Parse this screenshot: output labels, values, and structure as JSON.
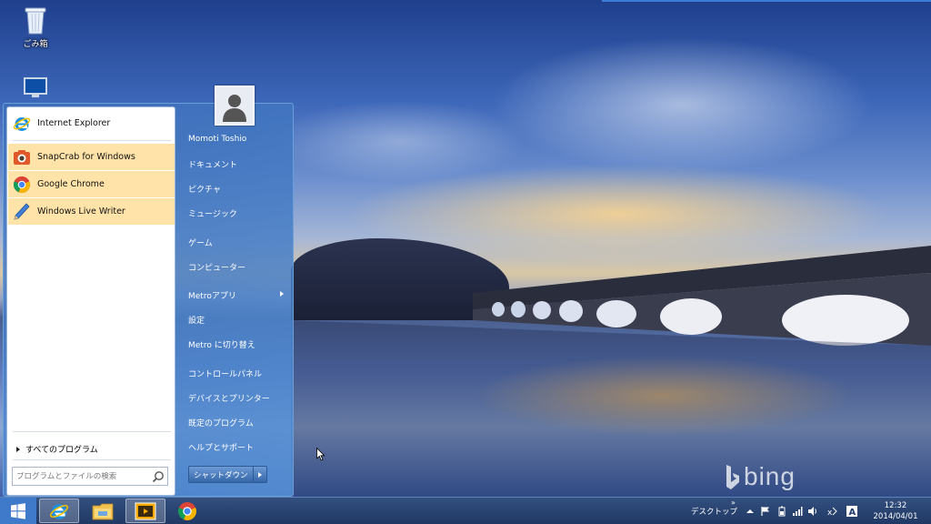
{
  "desktop": {
    "icons": [
      {
        "label": "ごみ箱"
      }
    ]
  },
  "start_menu": {
    "programs": [
      {
        "label": "Internet Explorer",
        "icon": "internet-explorer-icon"
      },
      {
        "label": "SnapCrab for Windows",
        "icon": "snapcrab-icon"
      },
      {
        "label": "Google Chrome",
        "icon": "chrome-icon"
      },
      {
        "label": "Windows Live Writer",
        "icon": "live-writer-icon"
      }
    ],
    "all_programs_label": "すべてのプログラム",
    "search_placeholder": "プログラムとファイルの検索",
    "user_name": "Momoti Toshio",
    "links": [
      "ドキュメント",
      "ピクチャ",
      "ミュージック",
      "ゲーム",
      "コンピューター",
      "Metroアプリ",
      "設定",
      "Metro に切り替え",
      "コントロールパネル",
      "デバイスとプリンター",
      "既定のプログラム",
      "ヘルプとサポート"
    ],
    "shutdown_label": "シャットダウン"
  },
  "taskbar": {
    "pinned": [
      "internet-explorer-icon",
      "file-explorer-icon",
      "media-player-icon",
      "chrome-icon"
    ],
    "toolbar_label": "デスクトップ",
    "toolbar_more": "»",
    "clock_time": "12:32",
    "clock_date": "2014/04/01"
  },
  "wallpaper": {
    "watermark": "bing"
  },
  "colors": {
    "pinned_highlight": "#ffe3a8",
    "menu_blue": "#4f86c9",
    "taskbar": "#1f3a6b"
  }
}
